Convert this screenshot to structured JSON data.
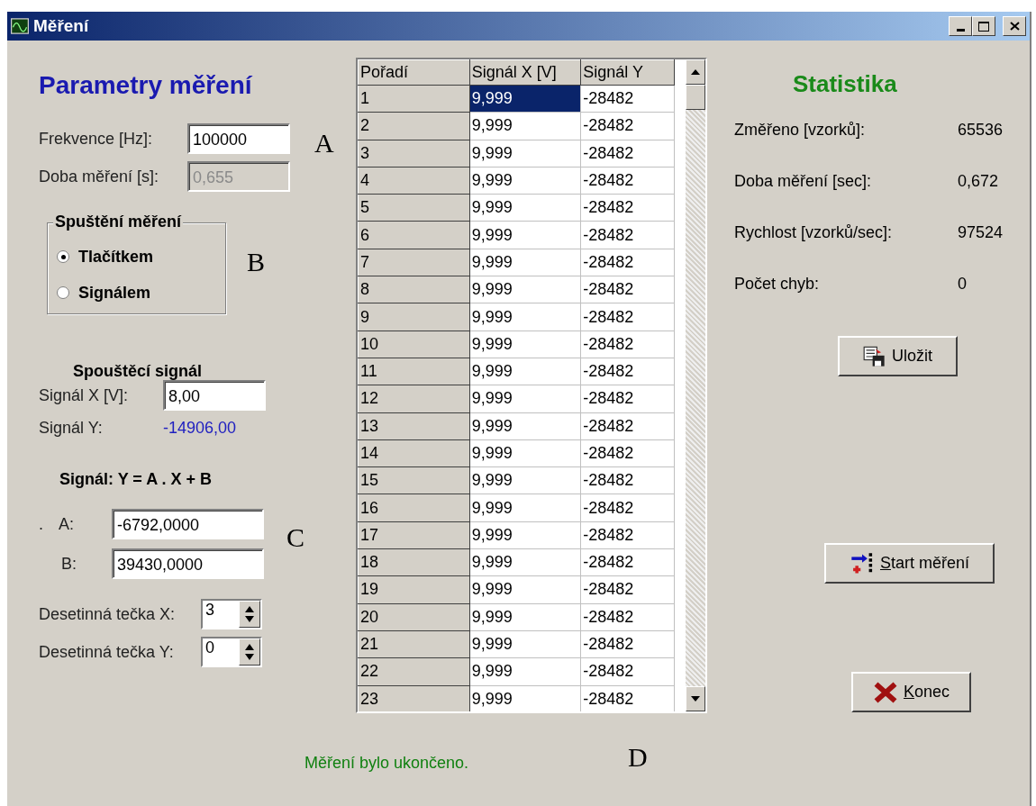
{
  "window": {
    "title": "Měření"
  },
  "parameters": {
    "title": "Parametry měření",
    "fields": [
      {
        "label": "Frekvence [Hz]:",
        "value": "100000",
        "disabled": false
      },
      {
        "label": "Doba měření [s]:",
        "value": "0,655",
        "disabled": true
      }
    ],
    "trigger_group": {
      "title": "Spuštění měření",
      "options": [
        {
          "label": "Tlačítkem",
          "selected": true
        },
        {
          "label": "Signálem",
          "selected": false
        }
      ]
    },
    "trigger_signal": {
      "title": "Spouštěcí signál",
      "x_label": "Signál X [V]:",
      "x_value": "8,00",
      "y_label": "Signál Y:",
      "y_value": "-14906,00"
    },
    "formula": {
      "title": "Signál: Y = A . X + B",
      "mark": ".",
      "fields": [
        {
          "label": "A:",
          "value": "-6792,0000"
        },
        {
          "label": "B:",
          "value": "39430,0000"
        }
      ]
    },
    "spinners": [
      {
        "label": "Desetinná tečka X:",
        "value": "3"
      },
      {
        "label": "Desetinná tečka Y:",
        "value": "0"
      }
    ]
  },
  "table": {
    "columns": [
      "Pořadí",
      "Signál X [V]",
      "Signál Y"
    ],
    "rows": [
      {
        "cells": [
          "1",
          "9,999",
          "-28482"
        ],
        "selected": true
      },
      {
        "cells": [
          "2",
          "9,999",
          "-28482"
        ],
        "selected": false
      },
      {
        "cells": [
          "3",
          "9,999",
          "-28482"
        ],
        "selected": false
      },
      {
        "cells": [
          "4",
          "9,999",
          "-28482"
        ],
        "selected": false
      },
      {
        "cells": [
          "5",
          "9,999",
          "-28482"
        ],
        "selected": false
      },
      {
        "cells": [
          "6",
          "9,999",
          "-28482"
        ],
        "selected": false
      },
      {
        "cells": [
          "7",
          "9,999",
          "-28482"
        ],
        "selected": false
      },
      {
        "cells": [
          "8",
          "9,999",
          "-28482"
        ],
        "selected": false
      },
      {
        "cells": [
          "9",
          "9,999",
          "-28482"
        ],
        "selected": false
      },
      {
        "cells": [
          "10",
          "9,999",
          "-28482"
        ],
        "selected": false
      },
      {
        "cells": [
          "11",
          "9,999",
          "-28482"
        ],
        "selected": false
      },
      {
        "cells": [
          "12",
          "9,999",
          "-28482"
        ],
        "selected": false
      },
      {
        "cells": [
          "13",
          "9,999",
          "-28482"
        ],
        "selected": false
      },
      {
        "cells": [
          "14",
          "9,999",
          "-28482"
        ],
        "selected": false
      },
      {
        "cells": [
          "15",
          "9,999",
          "-28482"
        ],
        "selected": false
      },
      {
        "cells": [
          "16",
          "9,999",
          "-28482"
        ],
        "selected": false
      },
      {
        "cells": [
          "17",
          "9,999",
          "-28482"
        ],
        "selected": false
      },
      {
        "cells": [
          "18",
          "9,999",
          "-28482"
        ],
        "selected": false
      },
      {
        "cells": [
          "19",
          "9,999",
          "-28482"
        ],
        "selected": false
      },
      {
        "cells": [
          "20",
          "9,999",
          "-28482"
        ],
        "selected": false
      },
      {
        "cells": [
          "21",
          "9,999",
          "-28482"
        ],
        "selected": false
      },
      {
        "cells": [
          "22",
          "9,999",
          "-28482"
        ],
        "selected": false
      },
      {
        "cells": [
          "23",
          "9,999",
          "-28482"
        ],
        "selected": false
      }
    ]
  },
  "status": "Měření bylo ukončeno.",
  "statistics": {
    "title": "Statistika",
    "rows": [
      {
        "label": "Změřeno [vzorků]:",
        "value": "65536"
      },
      {
        "label": "Doba měření [sec]:",
        "value": "0,672"
      },
      {
        "label": "Rychlost [vzorků/sec]:",
        "value": "97524"
      },
      {
        "label": "Počet chyb:",
        "value": "0"
      }
    ]
  },
  "buttons": [
    {
      "kind": "save",
      "label": "Uložit"
    },
    {
      "kind": "start",
      "label": "Start měření"
    },
    {
      "kind": "exit",
      "label": "Konec"
    }
  ],
  "annotations": [
    "A",
    "B",
    "C",
    "D"
  ]
}
